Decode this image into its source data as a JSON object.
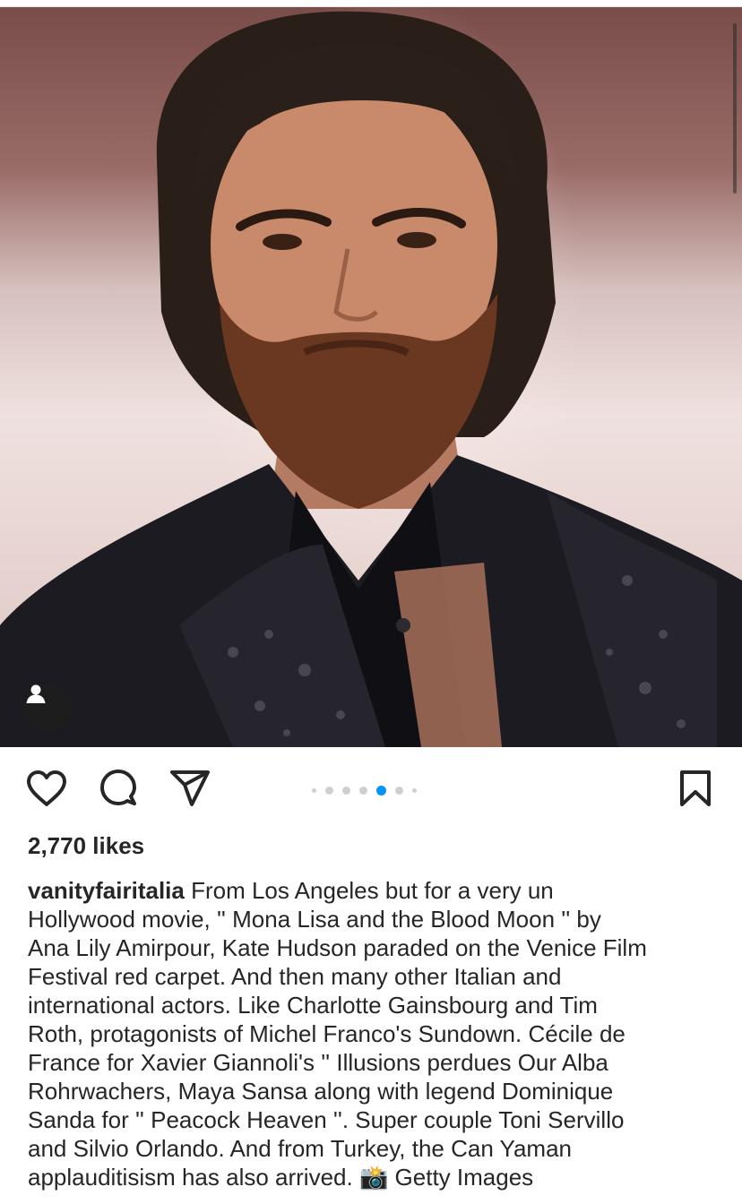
{
  "post": {
    "likes_text": "2,770 likes",
    "username": "vanityfairitalia",
    "caption_lines": [
      "From Los Angeles but for a very un",
      "Hollywood movie, '' Mona Lisa and the Blood Moon '' by",
      "Ana Lily Amirpour, Kate Hudson paraded on the Venice Film",
      "Festival red carpet. And then many other Italian and",
      "international actors. Like Charlotte Gainsbourg and Tim",
      "Roth, protagonists of Michel Franco's Sundown. Cécile de",
      "France for Xavier Giannoli's '' Illusions perdues Our Alba",
      "Rohrwachers, Maya Sansa along with legend Dominique",
      "Sanda for '' Peacock Heaven ''. Super couple Toni Servillo",
      "and Silvio Orlando. And from Turkey, the Can Yaman",
      "applauditisism has also arrived. 📸 Getty Images"
    ]
  },
  "carousel": {
    "total": 7,
    "active_index": 4
  },
  "icons": {
    "like": "heart-icon",
    "comment": "comment-icon",
    "share": "paper-plane-icon",
    "save": "bookmark-icon",
    "tag": "person-icon"
  },
  "colors": {
    "accent": "#0095f6",
    "text": "#262626",
    "dot_inactive": "#cfcfcf"
  }
}
